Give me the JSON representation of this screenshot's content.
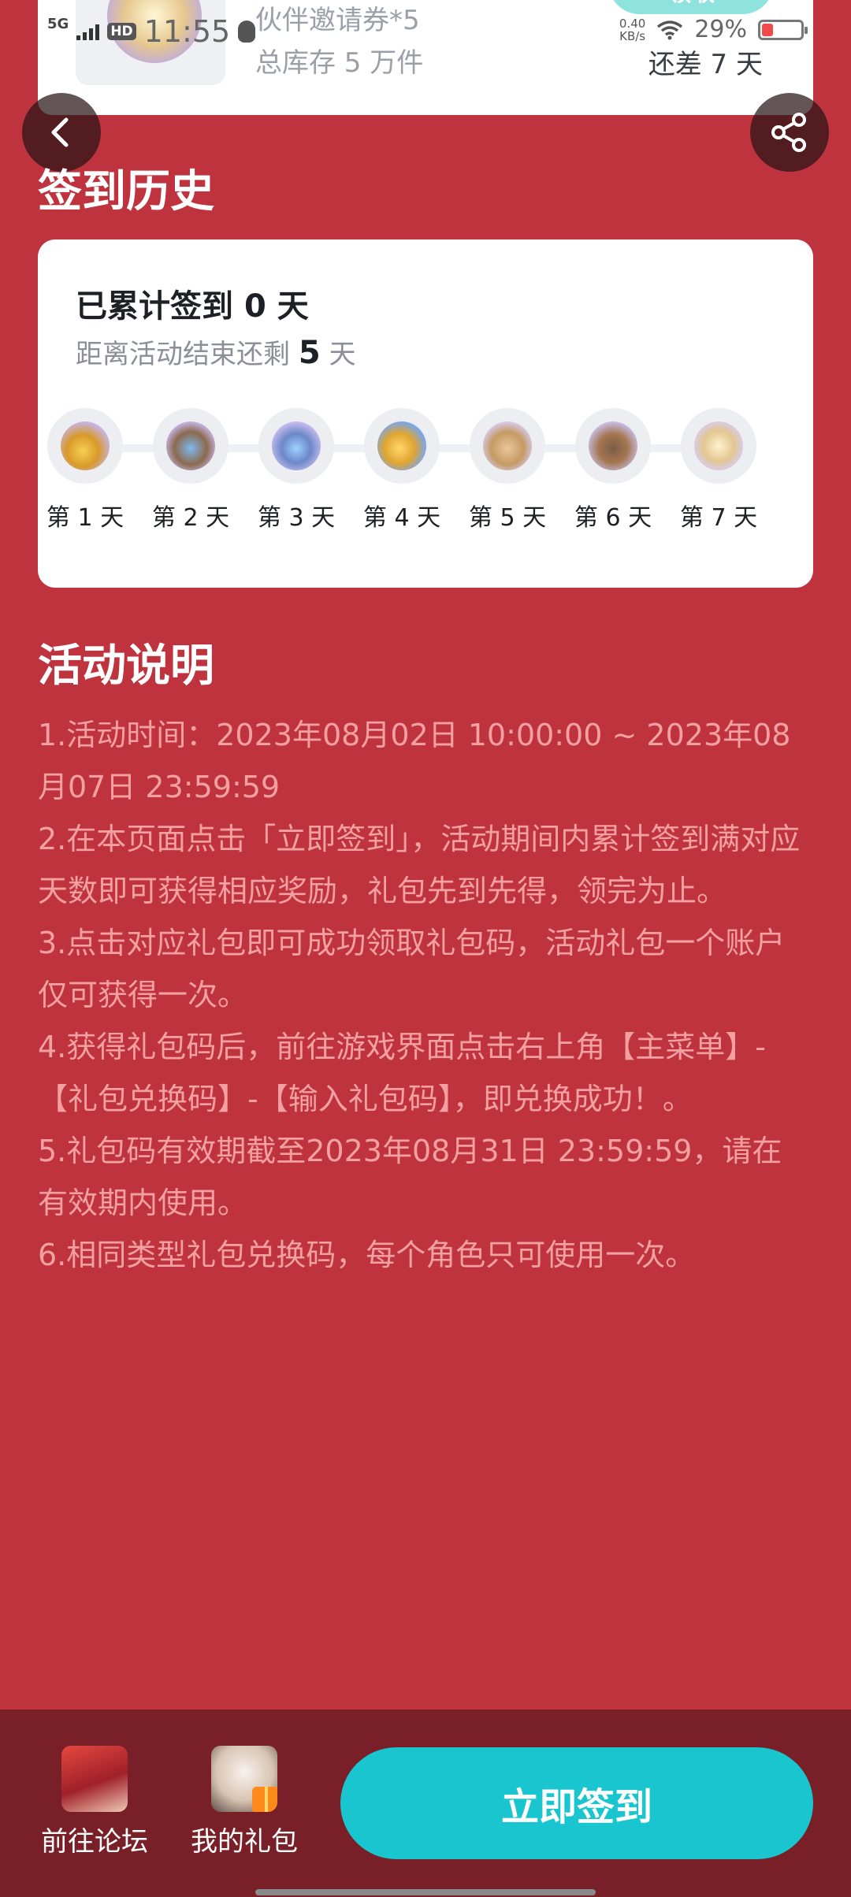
{
  "status_bar": {
    "network": "5G",
    "hd": "HD",
    "time": "11:55",
    "speed_value": "0.40",
    "speed_unit": "KB/s",
    "battery_percent": "29%",
    "battery_level": 0.29,
    "battery_color": "#f04a4a"
  },
  "top_card": {
    "reward_name": "伙伴邀请券*5",
    "stock": "总库存 5 万件",
    "claim_label": "领取",
    "days_left": "还差 7 天"
  },
  "history": {
    "title": "签到历史",
    "cumulative_prefix": "已累计签到",
    "cumulative_count": "0",
    "cumulative_suffix": "天",
    "remain_prefix": "距离活动结束还剩",
    "remain_count": "5",
    "remain_suffix": "天",
    "days": [
      {
        "label": "第 1 天",
        "icon": "coins-gift-icon"
      },
      {
        "label": "第 2 天",
        "icon": "crystal-chest-icon"
      },
      {
        "label": "第 3 天",
        "icon": "crystal-pile-icon"
      },
      {
        "label": "第 4 天",
        "icon": "gold-coins-icon"
      },
      {
        "label": "第 5 天",
        "icon": "supply-boxes-icon"
      },
      {
        "label": "第 6 天",
        "icon": "treasure-cart-icon"
      },
      {
        "label": "第 7 天",
        "icon": "partner-ticket-icon"
      }
    ]
  },
  "rules": {
    "title": "活动说明",
    "items": [
      "1.活动时间：2023年08月02日 10:00:00 ~ 2023年08月07日 23:59:59",
      "2.在本页面点击「立即签到」，活动期间内累计签到满对应天数即可获得相应奖励，礼包先到先得，领完为止。",
      "3.点击对应礼包即可成功领取礼包码，活动礼包一个账户仅可获得一次。",
      "4.获得礼包码后，前往游戏界面点击右上角【主菜单】-【礼包兑换码】-【输入礼包码】，即兑换成功！。",
      "5.礼包码有效期截至2023年08月31日 23:59:59，请在有效期内使用。",
      "6.相同类型礼包兑换码，每个角色只可使用一次。"
    ]
  },
  "bottom_bar": {
    "forum_label": "前往论坛",
    "gifts_label": "我的礼包",
    "sign_label": "立即签到"
  },
  "colors": {
    "background": "#bf333e",
    "bottom_bar": "#791f27",
    "accent": "#19c5cf",
    "rule_text": "#f2a0a2"
  }
}
